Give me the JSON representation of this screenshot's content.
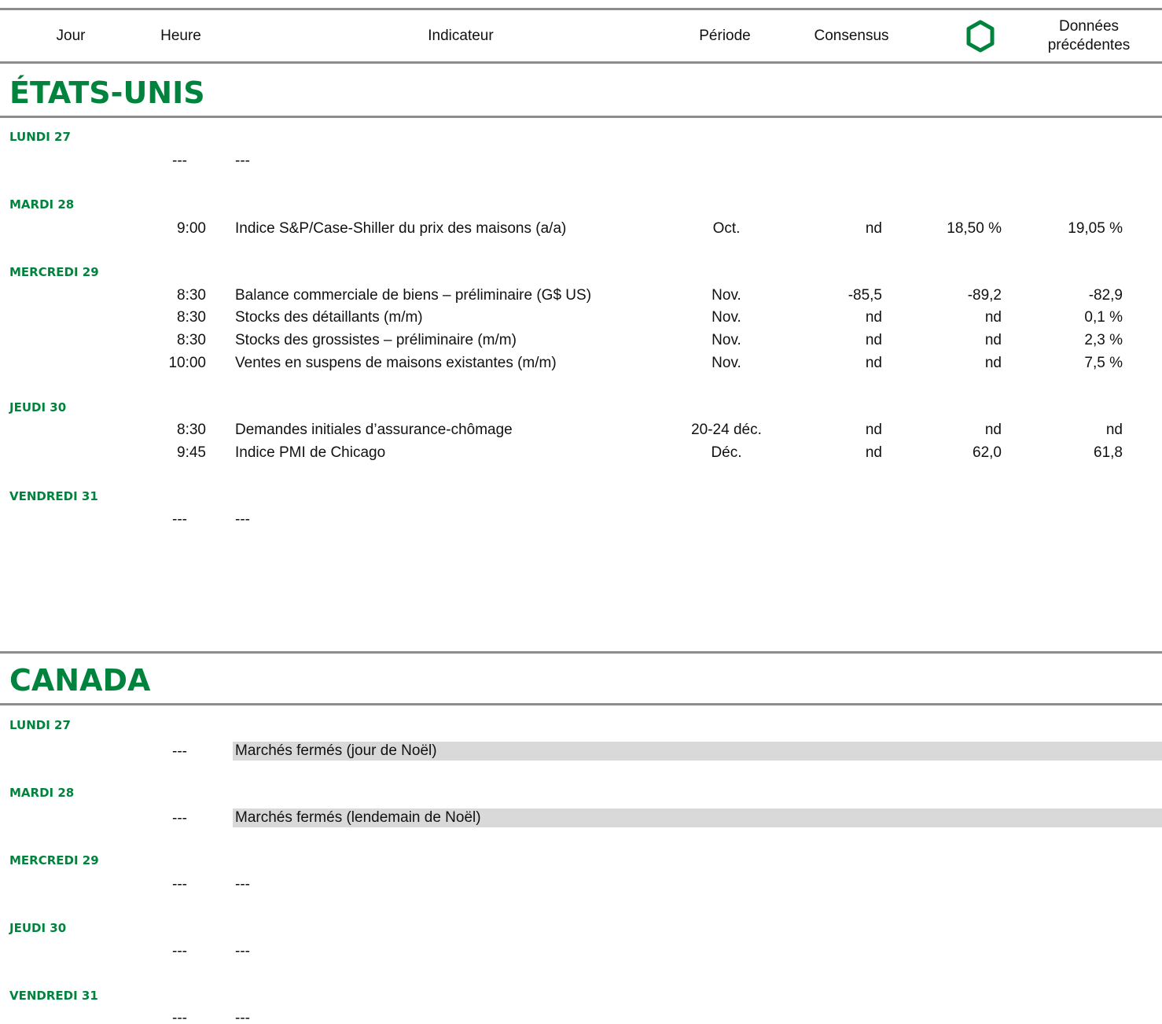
{
  "colors": {
    "accent": "#00843d",
    "rule": "#8c8c8c",
    "closed_bg": "#d9d9d9"
  },
  "header": {
    "jour": "Jour",
    "heure": "Heure",
    "indicateur": "Indicateur",
    "periode": "Période",
    "consensus": "Consensus",
    "td_icon": "hexagon-logo-icon",
    "donnees_line1": "Données",
    "donnees_line2": "précédentes"
  },
  "us": {
    "title": "ÉTATS-UNIS",
    "days": [
      {
        "label": "LUNDI 27",
        "rows": [
          {
            "time": "---",
            "indicator": "---"
          }
        ]
      },
      {
        "label": "MARDI 28",
        "rows": [
          {
            "time": "9:00",
            "indicator": "Indice S&P/Case-Shiller du prix des maisons (a/a)",
            "period": "Oct.",
            "consensus": "nd",
            "td": "18,50 %",
            "previous": "19,05 %"
          }
        ]
      },
      {
        "label": "MERCREDI 29",
        "rows": [
          {
            "time": "8:30",
            "indicator": "Balance commerciale de biens – préliminaire (G$ US)",
            "period": "Nov.",
            "consensus": "-85,5",
            "td": "-89,2",
            "previous": "-82,9"
          },
          {
            "time": "8:30",
            "indicator": "Stocks des détaillants (m/m)",
            "period": "Nov.",
            "consensus": "nd",
            "td": "nd",
            "previous": "0,1 %"
          },
          {
            "time": "8:30",
            "indicator": "Stocks des grossistes – préliminaire (m/m)",
            "period": "Nov.",
            "consensus": "nd",
            "td": "nd",
            "previous": "2,3 %"
          },
          {
            "time": "10:00",
            "indicator": "Ventes en suspens de maisons existantes (m/m)",
            "period": "Nov.",
            "consensus": "nd",
            "td": "nd",
            "previous": "7,5 %"
          }
        ]
      },
      {
        "label": "JEUDI 30",
        "rows": [
          {
            "time": "8:30",
            "indicator": "Demandes initiales d’assurance-chômage",
            "period": "20-24 déc.",
            "consensus": "nd",
            "td": "nd",
            "previous": "nd"
          },
          {
            "time": "9:45",
            "indicator": "Indice PMI de Chicago",
            "period": "Déc.",
            "consensus": "nd",
            "td": "62,0",
            "previous": "61,8"
          }
        ]
      },
      {
        "label": "VENDREDI 31",
        "rows": [
          {
            "time": "---",
            "indicator": "---"
          }
        ]
      }
    ]
  },
  "canada": {
    "title": "CANADA",
    "days": [
      {
        "label": "LUNDI 27",
        "rows": [
          {
            "time": "---",
            "closed": "Marchés fermés (jour de Noël)"
          }
        ]
      },
      {
        "label": "MARDI 28",
        "rows": [
          {
            "time": "---",
            "closed": "Marchés fermés (lendemain de Noël)"
          }
        ]
      },
      {
        "label": "MERCREDI 29",
        "rows": [
          {
            "time": "---",
            "indicator": "---"
          }
        ]
      },
      {
        "label": "JEUDI 30",
        "rows": [
          {
            "time": "---",
            "indicator": "---"
          }
        ]
      },
      {
        "label": "VENDREDI 31",
        "rows": [
          {
            "time": "---",
            "indicator": "---"
          }
        ]
      }
    ]
  }
}
